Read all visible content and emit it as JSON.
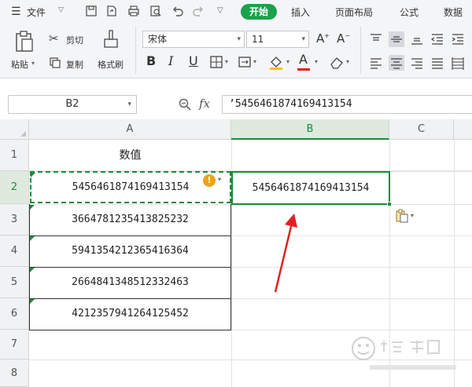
{
  "menubar": {
    "file_label": "文件",
    "tabs": [
      "开始",
      "插入",
      "页面布局",
      "公式",
      "数据"
    ]
  },
  "ribbon": {
    "paste_label": "粘贴",
    "cut_label": "剪切",
    "copy_label": "复制",
    "format_painter_label": "格式刷",
    "font_name": "宋体",
    "font_size": "11"
  },
  "formula_bar": {
    "name_box": "B2",
    "fx_label": "fx",
    "content": "’5456461874169413154"
  },
  "grid": {
    "columns": [
      "A",
      "B",
      "C"
    ],
    "rows": [
      "1",
      "2",
      "3",
      "4",
      "5",
      "6",
      "7",
      "8"
    ],
    "header_cell": "数值",
    "a_values": [
      "5456461874169413154",
      "3664781235413825232",
      "5941354212365416364",
      "2664841348512332463",
      "4212357941264125452"
    ],
    "b2_value": "5456461874169413154"
  },
  "colors": {
    "accent_green": "#1aa34a",
    "selection_green": "#1e8a3b",
    "arrow_red": "#e02020",
    "warning_orange": "#f0a020"
  }
}
